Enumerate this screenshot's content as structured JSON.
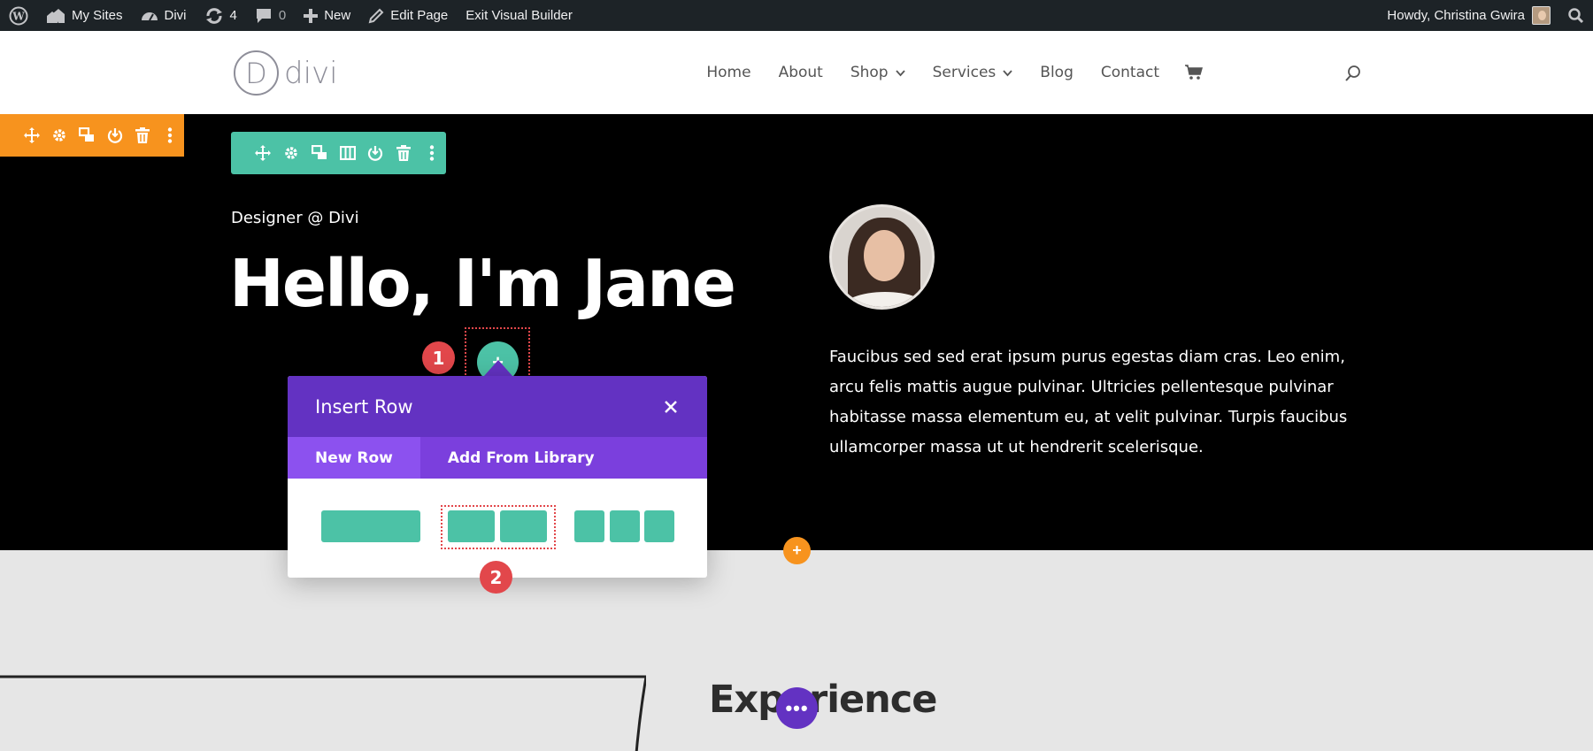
{
  "adminbar": {
    "my_sites": "My Sites",
    "site_name": "Divi",
    "updates_count": "4",
    "comments_count": "0",
    "new_label": "New",
    "edit_page": "Edit Page",
    "exit_builder": "Exit Visual Builder",
    "greeting": "Howdy, Christina Gwira"
  },
  "header": {
    "logo_letter": "D",
    "logo_text": "divi",
    "nav": [
      "Home",
      "About",
      "Shop",
      "Services",
      "Blog",
      "Contact"
    ]
  },
  "hero": {
    "subtitle": "Designer @ Divi",
    "title": "Hello, I'm Jane",
    "body": "Faucibus sed sed erat ipsum purus egestas diam cras. Leo enim, arcu felis mattis augue pulvinar. Ultricies pellentesque pulvinar habitasse massa elementum eu, at velit pulvinar. Turpis faucibus ullamcorper massa ut ut hendrerit scelerisque."
  },
  "callouts": {
    "one": "1",
    "two": "2"
  },
  "modal": {
    "title": "Insert Row",
    "tabs": {
      "new_row": "New Row",
      "library": "Add From Library"
    }
  },
  "lower": {
    "heading": "Experience"
  },
  "colors": {
    "section_toolbar": "#f7931e",
    "row_toolbar": "#4cc2a6",
    "modal_purple": "#6332c2",
    "callout_red": "#e2474b"
  }
}
